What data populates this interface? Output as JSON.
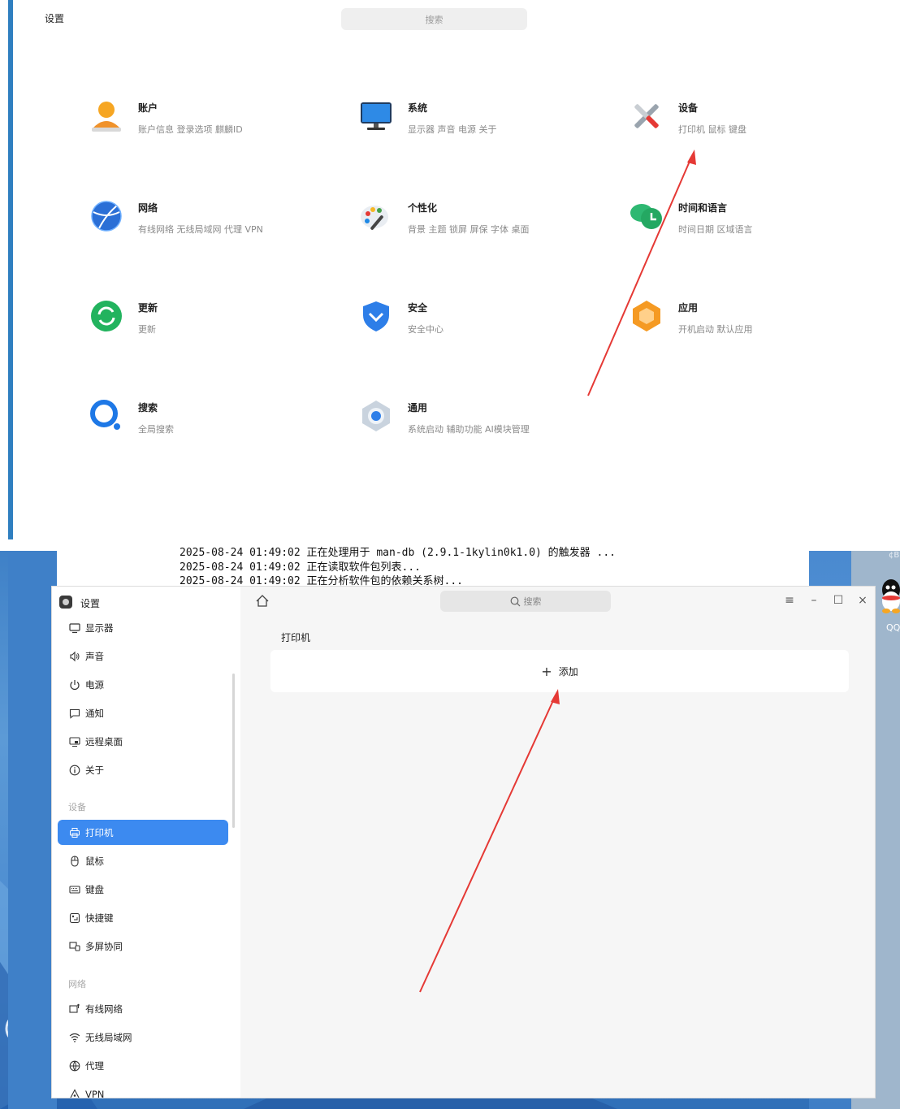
{
  "top_panel": {
    "title": "设置",
    "search_placeholder": "搜索",
    "categories": [
      {
        "name": "账户",
        "desc": "账户信息 登录选项 麒麟ID",
        "icon": "account-icon"
      },
      {
        "name": "系统",
        "desc": "显示器 声音 电源 关于",
        "icon": "system-monitor-icon"
      },
      {
        "name": "设备",
        "desc": "打印机 鼠标 键盘",
        "icon": "devices-tools-icon"
      },
      {
        "name": "网络",
        "desc": "有线网络 无线局域网 代理 VPN",
        "icon": "network-globe-icon"
      },
      {
        "name": "个性化",
        "desc": "背景 主题 锁屏 屏保 字体 桌面",
        "icon": "palette-icon"
      },
      {
        "name": "时间和语言",
        "desc": "时间日期 区域语言",
        "icon": "time-language-icon"
      },
      {
        "name": "更新",
        "desc": "更新",
        "icon": "update-icon"
      },
      {
        "name": "安全",
        "desc": "安全中心",
        "icon": "security-shield-icon"
      },
      {
        "name": "应用",
        "desc": "开机启动 默认应用",
        "icon": "apps-hexagon-icon"
      },
      {
        "name": "搜索",
        "desc": "全局搜索",
        "icon": "search-magnifier-icon"
      },
      {
        "name": "通用",
        "desc": "系统启动 辅助功能 AI模块管理",
        "icon": "general-settings-icon"
      }
    ]
  },
  "terminal": {
    "lines": [
      "2025-08-24 01:49:02 正在处理用于 man-db (2.9.1-1kylin0k1.0) 的触发器 ...",
      "2025-08-24 01:49:02 正在读取软件包列表...",
      "2025-08-24 01:49:02 正在分析软件包的依赖关系树..."
    ]
  },
  "desktop": {
    "qq_label": "QQ",
    "corner_text": "¢B"
  },
  "window": {
    "title": "设置",
    "search_placeholder": "搜索",
    "controls": {
      "menu": "≡",
      "minimize": "–",
      "maximize": "☐",
      "close": "×"
    },
    "sidebar": {
      "items_system": [
        {
          "label": "显示器",
          "icon": "monitor-icon"
        },
        {
          "label": "声音",
          "icon": "speaker-icon"
        },
        {
          "label": "电源",
          "icon": "power-icon"
        },
        {
          "label": "通知",
          "icon": "notification-icon"
        },
        {
          "label": "远程桌面",
          "icon": "remote-desktop-icon"
        },
        {
          "label": "关于",
          "icon": "info-icon"
        }
      ],
      "group_devices": "设备",
      "items_devices": [
        {
          "label": "打印机",
          "icon": "printer-icon",
          "active": true
        },
        {
          "label": "鼠标",
          "icon": "mouse-icon"
        },
        {
          "label": "键盘",
          "icon": "keyboard-icon"
        },
        {
          "label": "快捷键",
          "icon": "shortcut-icon"
        },
        {
          "label": "多屏协同",
          "icon": "multi-screen-icon"
        }
      ],
      "group_network": "网络",
      "items_network": [
        {
          "label": "有线网络",
          "icon": "wired-network-icon"
        },
        {
          "label": "无线局域网",
          "icon": "wifi-icon"
        },
        {
          "label": "代理",
          "icon": "proxy-icon"
        },
        {
          "label": "VPN",
          "icon": "vpn-icon"
        }
      ]
    },
    "content": {
      "page_title": "打印机",
      "add_label": "添加"
    }
  },
  "annotation_color": "#e53935"
}
